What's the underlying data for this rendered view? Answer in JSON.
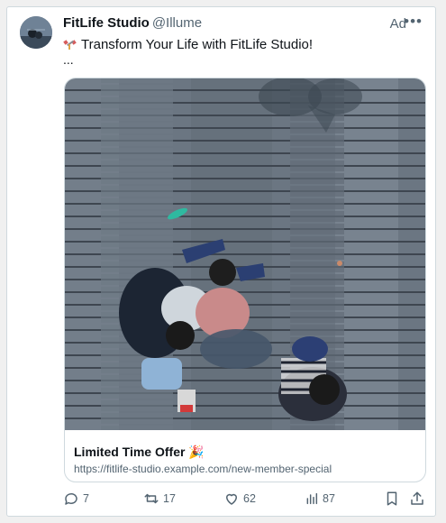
{
  "post": {
    "account_name": "FitLife Studio",
    "handle": "@Illume",
    "ad_label": "Ad",
    "more_label": "•••",
    "text": "Transform Your Life with FitLife Studio!",
    "ellipsis": "...",
    "emoji_icon": "dumbbell-emoji-icon"
  },
  "card": {
    "title": "Limited Time Offer 🎉",
    "url": "https://fitlife-studio.example.com/new-member-special",
    "image_description_icon": "people-sitting-on-boardwalk-photo"
  },
  "actions": {
    "replies": "7",
    "reposts": "17",
    "likes": "62",
    "views": "87"
  },
  "colors": {
    "text": "#0f1419",
    "muted": "#536471",
    "border": "#cfd9de"
  }
}
